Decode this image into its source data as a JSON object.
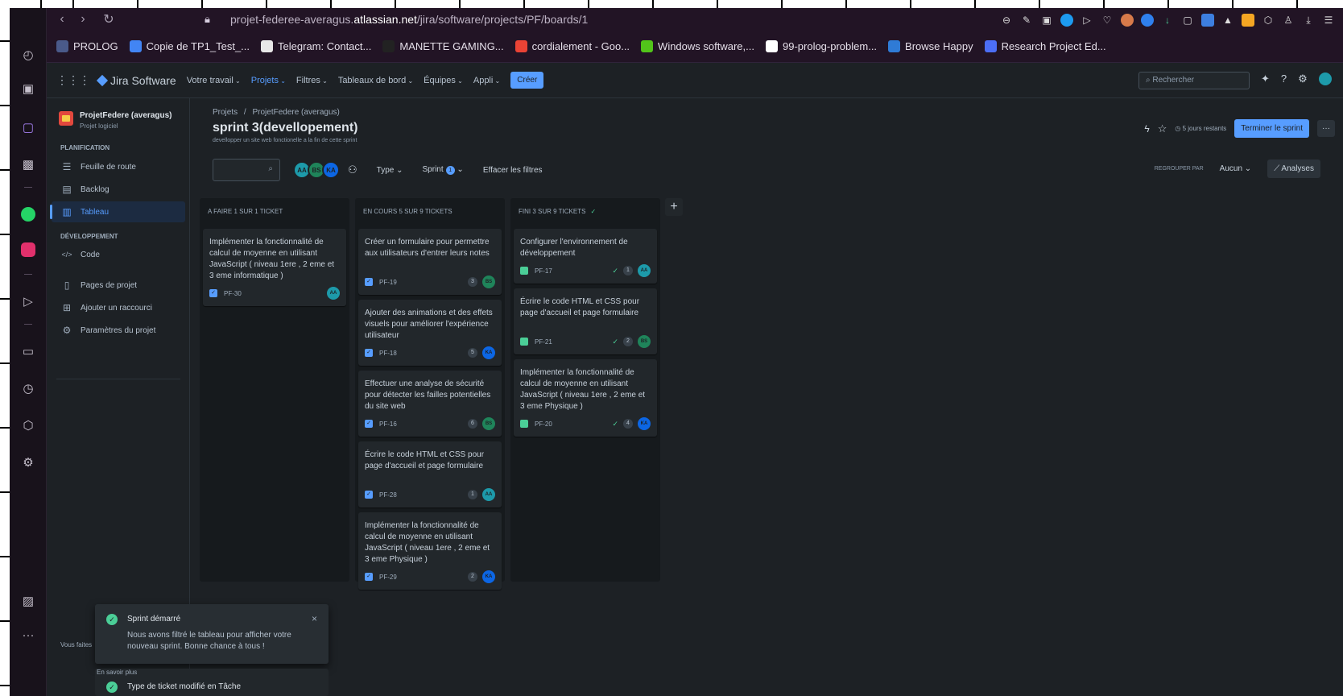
{
  "browser": {
    "url_prefix": "projet-federee-averagus.",
    "url_domain": "atlassian.net",
    "url_path": "/jira/software/projects/PF/boards/1",
    "bookmarks": [
      {
        "label": "PROLOG",
        "icon": "prolog-icon",
        "color": "#4a5a8a"
      },
      {
        "label": "Copie de TP1_Test_...",
        "icon": "docs-icon",
        "color": "#4285f4"
      },
      {
        "label": "Telegram: Contact...",
        "icon": "file-icon",
        "color": "#e8e8e8"
      },
      {
        "label": "MANETTE GAMING...",
        "icon": "sbs-icon",
        "color": "#222222"
      },
      {
        "label": "cordialement - Goo...",
        "icon": "google-icon",
        "color": "#ea4335"
      },
      {
        "label": "Windows software,...",
        "icon": "software-icon",
        "color": "#52c41a"
      },
      {
        "label": "99-prolog-problem...",
        "icon": "github-icon",
        "color": "#ffffff"
      },
      {
        "label": "Browse Happy",
        "icon": "browsehappy-icon",
        "color": "#2f7bd6"
      },
      {
        "label": "Research Project Ed...",
        "icon": "research-icon",
        "color": "#4c6ef5"
      }
    ]
  },
  "jira_nav": {
    "product": "Jira Software",
    "items": [
      "Votre travail",
      "Projets",
      "Filtres",
      "Tableaux de bord",
      "Équipes",
      "Appli"
    ],
    "active_index": 1,
    "create_label": "Créer",
    "search_placeholder": "Rechercher"
  },
  "project": {
    "name": "ProjetFedere (averagus)",
    "type": "Projet logiciel",
    "planning_title": "PLANIFICATION",
    "planning_items": [
      {
        "label": "Feuille de route",
        "icon": "roadmap-icon"
      },
      {
        "label": "Backlog",
        "icon": "backlog-icon"
      },
      {
        "label": "Tableau",
        "icon": "board-icon"
      }
    ],
    "dev_title": "DÉVELOPPEMENT",
    "dev_items": [
      {
        "label": "Code",
        "icon": "code-icon"
      }
    ],
    "other_items": [
      {
        "label": "Pages de projet",
        "icon": "pages-icon"
      },
      {
        "label": "Ajouter un raccourci",
        "icon": "shortcut-icon"
      },
      {
        "label": "Paramètres du projet",
        "icon": "settings-icon"
      }
    ],
    "footer": "Vous faites"
  },
  "board": {
    "breadcrumb": [
      "Projets",
      "ProjetFedere (averagus)"
    ],
    "title": "sprint 3(devellopement)",
    "goal": "devellopper un site web fonctionelle a la fin de cette sprint",
    "days_remaining": "5 jours restants",
    "finish_label": "Terminer le sprint",
    "more_label": "···",
    "filters": {
      "type_label": "Type",
      "sprint_label": "Sprint",
      "sprint_count": "1",
      "clear_label": "Effacer les filtres",
      "group_by_label": "REGROUPER PAR",
      "group_value": "Aucun",
      "analyses_label": "Analyses"
    },
    "assignees": [
      {
        "initials": "AA",
        "color": "#1d9aaa"
      },
      {
        "initials": "BS",
        "color": "#1f845a"
      },
      {
        "initials": "KA",
        "color": "#0c66e4"
      }
    ],
    "columns": [
      {
        "title": "A FAIRE 1 SUR 1 TICKET",
        "done": false,
        "cards": [
          {
            "title": "Implémenter la fonctionnalité de calcul de moyenne en utilisant JavaScript ( niveau 1ere , 2 eme et 3 eme informatique )",
            "key": "PF-30",
            "type": "task",
            "points": "",
            "assignee": "AA",
            "color": "#1d9aaa"
          }
        ]
      },
      {
        "title": "EN COURS 5 SUR 9 TICKETS",
        "done": false,
        "cards": [
          {
            "title": "Créer un formulaire pour permettre aux utilisateurs d'entrer leurs notes",
            "key": "PF-19",
            "type": "task",
            "points": "3",
            "assignee": "BS",
            "color": "#1f845a"
          },
          {
            "title": "Ajouter des animations et des effets visuels pour améliorer l'expérience utilisateur",
            "key": "PF-18",
            "type": "task",
            "points": "5",
            "assignee": "KA",
            "color": "#0c66e4"
          },
          {
            "title": "Effectuer une analyse de sécurité pour détecter les failles potentielles du site web",
            "key": "PF-16",
            "type": "task",
            "points": "6",
            "assignee": "BS",
            "color": "#1f845a"
          },
          {
            "title": "Écrire le code HTML et CSS pour page d'accueil et page formulaire",
            "key": "PF-28",
            "type": "task",
            "points": "1",
            "assignee": "AA",
            "color": "#1d9aaa"
          },
          {
            "title": "Implémenter la fonctionnalité de calcul de moyenne en utilisant JavaScript ( niveau 1ere , 2 eme et 3 eme Physique )",
            "key": "PF-29",
            "type": "task",
            "points": "2",
            "assignee": "KA",
            "color": "#0c66e4"
          }
        ]
      },
      {
        "title": "FINI 3 SUR 9 TICKETS",
        "done": true,
        "cards": [
          {
            "title": "Configurer l'environnement de développement",
            "key": "PF-17",
            "type": "story",
            "points": "1",
            "assignee": "AA",
            "color": "#1d9aaa"
          },
          {
            "title": "Écrire le code HTML et CSS pour page d'accueil et page formulaire",
            "key": "PF-21",
            "type": "story",
            "points": "2",
            "assignee": "BS",
            "color": "#1f845a"
          },
          {
            "title": "Implémenter la fonctionnalité de calcul de moyenne en utilisant JavaScript ( niveau 1ere , 2 eme et 3 eme Physique )",
            "key": "PF-20",
            "type": "story",
            "points": "4",
            "assignee": "KA",
            "color": "#0c66e4"
          }
        ]
      }
    ]
  },
  "toast": {
    "title": "Sprint démarré",
    "message": "Nous avons filtré le tableau pour afficher votre nouveau sprint. Bonne chance à tous !",
    "close": "×",
    "learn_more": "En savoir plus",
    "second_title": "Type de ticket modifié en Tâche"
  }
}
